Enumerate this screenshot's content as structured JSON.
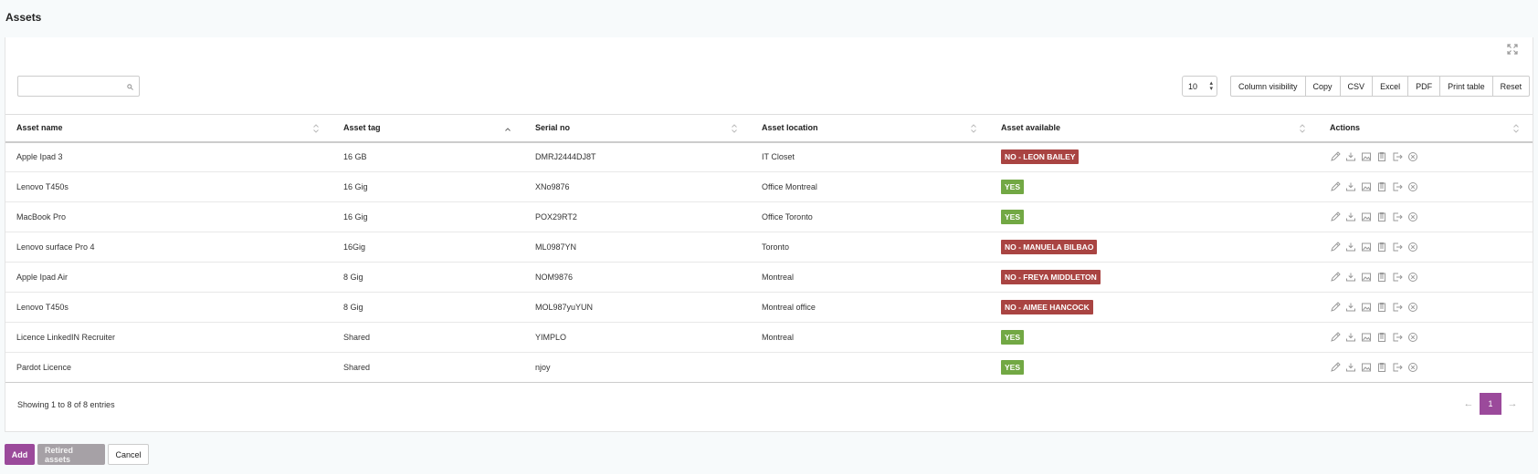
{
  "page": {
    "title": "Assets"
  },
  "toolbar": {
    "search_value": "",
    "page_size": "10",
    "buttons": [
      "Column visibility",
      "Copy",
      "CSV",
      "Excel",
      "PDF",
      "Print table",
      "Reset"
    ]
  },
  "table": {
    "columns": [
      "Asset name",
      "Asset tag",
      "Serial no",
      "Asset location",
      "Asset available",
      "Actions"
    ],
    "rows": [
      {
        "name": "Apple Ipad 3",
        "tag": "16 GB",
        "serial": "DMRJ2444DJ8T",
        "location": "IT Closet",
        "available": "NO - LEON BAILEY",
        "status": "no"
      },
      {
        "name": "Lenovo T450s",
        "tag": "16 Gig",
        "serial": "XNo9876",
        "location": "Office Montreal",
        "available": "YES",
        "status": "yes"
      },
      {
        "name": "MacBook Pro",
        "tag": "16 Gig",
        "serial": "POX29RT2",
        "location": "Office Toronto",
        "available": "YES",
        "status": "yes"
      },
      {
        "name": "Lenovo surface Pro 4",
        "tag": "16Gig",
        "serial": "ML0987YN",
        "location": "Toronto",
        "available": "NO - MANUELA BILBAO",
        "status": "no"
      },
      {
        "name": "Apple Ipad Air",
        "tag": "8 Gig",
        "serial": "NOM9876",
        "location": "Montreal",
        "available": "NO - FREYA MIDDLETON",
        "status": "no"
      },
      {
        "name": "Lenovo T450s",
        "tag": "8 Gig",
        "serial": "MOL987yuYUN",
        "location": "Montreal office",
        "available": "NO - AIMEE HANCOCK",
        "status": "no"
      },
      {
        "name": "Licence LinkedIN Recruiter",
        "tag": "Shared",
        "serial": "YIMPLO",
        "location": "Montreal",
        "available": "YES",
        "status": "yes"
      },
      {
        "name": "Pardot Licence",
        "tag": "Shared",
        "serial": "njoy",
        "location": "",
        "available": "YES",
        "status": "yes"
      }
    ],
    "action_icons": [
      "edit-icon",
      "download-icon",
      "image-icon",
      "clipboard-icon",
      "checkout-icon",
      "delete-icon"
    ]
  },
  "pagination": {
    "info": "Showing 1 to 8 of 8 entries",
    "prev": "←",
    "current": "1",
    "next": "→"
  },
  "footer": {
    "add": "Add",
    "retired": "Retired assets",
    "cancel": "Cancel"
  },
  "colors": {
    "accent": "#9b4a9b",
    "no_badge": "#a94442",
    "yes_badge": "#72a844"
  }
}
